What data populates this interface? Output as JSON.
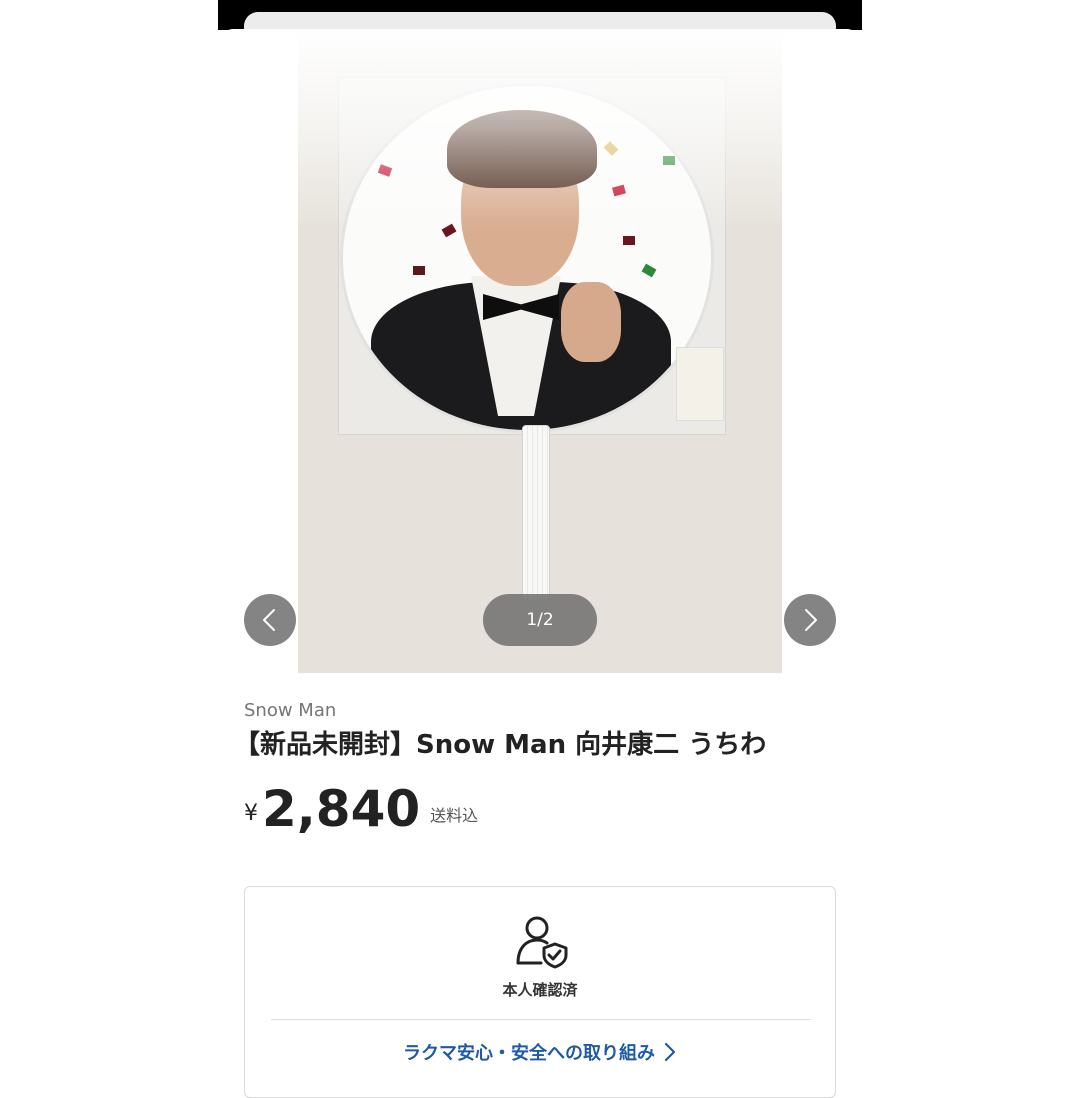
{
  "gallery": {
    "page_indicator": "1/2",
    "icons": {
      "back": "chevron-left-icon",
      "more": "more-horizontal-icon",
      "prev": "chevron-left-icon",
      "next": "chevron-right-icon"
    }
  },
  "product": {
    "brand": "Snow Man",
    "title": "【新品未開封】Snow Man 向井康二 うちわ",
    "currency_symbol": "¥",
    "price": "2,840",
    "shipping_note": "送料込"
  },
  "trust_card": {
    "verified_label": "本人確認済",
    "verified_icon": "user-shield-check-icon",
    "safety_link": "ラクマ安心・安全への取り組み",
    "link_color": "#1f5aa8"
  }
}
